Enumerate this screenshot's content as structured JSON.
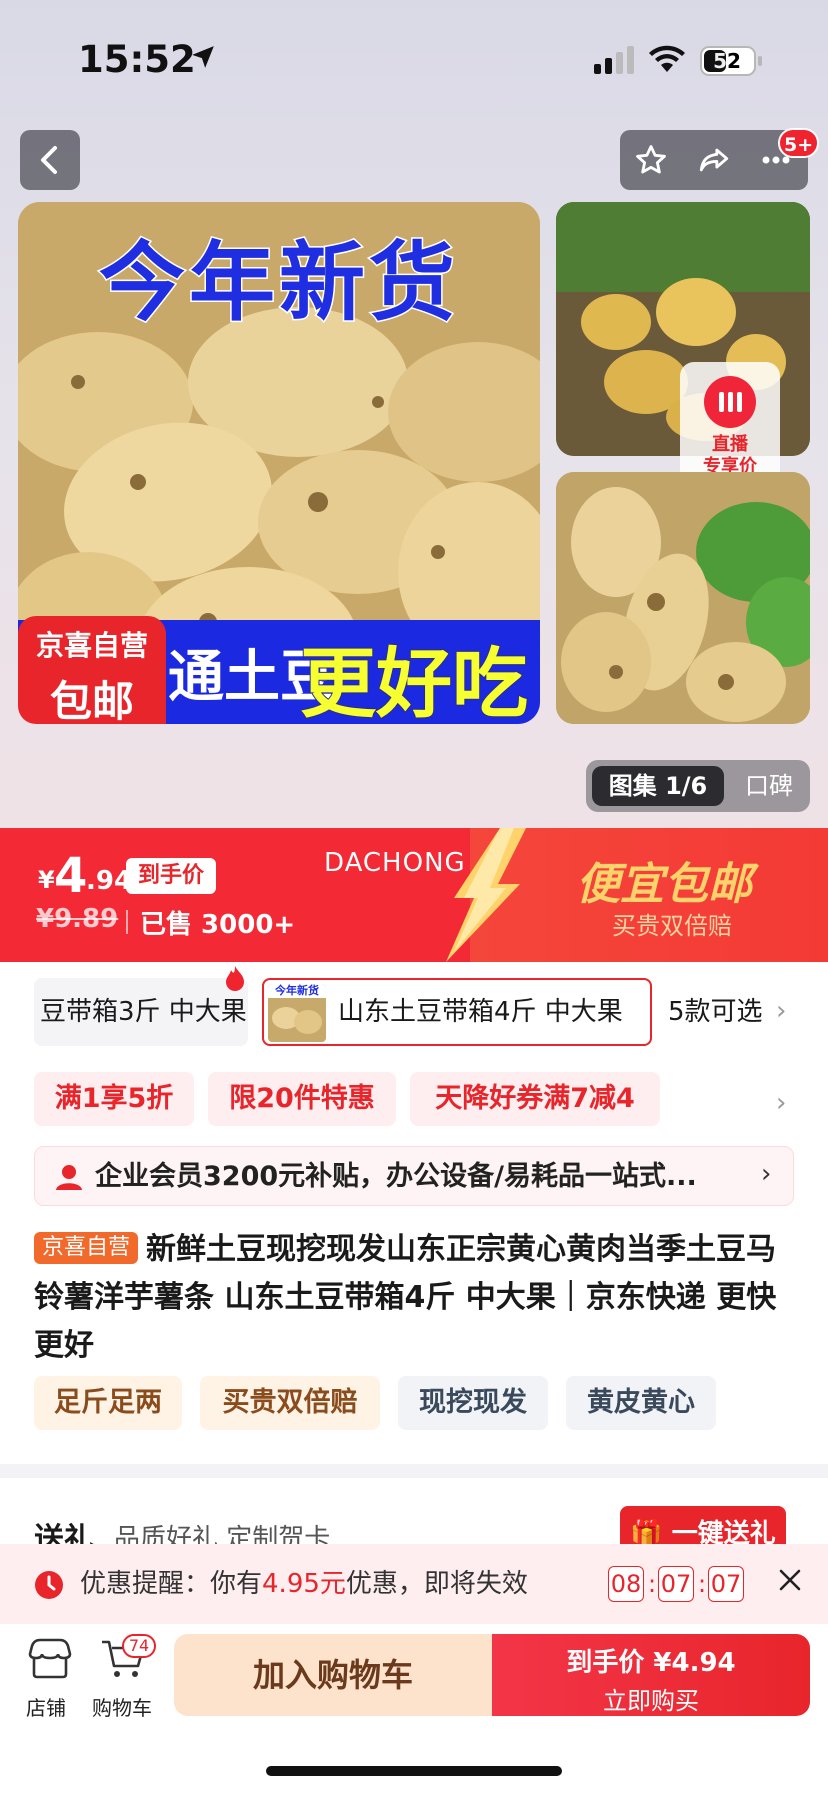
{
  "status": {
    "time": "15:52",
    "battery": "52"
  },
  "nav": {
    "badge": "5+"
  },
  "gallery": {
    "banner_top": "今年新货",
    "banner_bottom_a": "通土豆",
    "banner_bottom_b": "更好吃",
    "stamp_line1": "京喜自营",
    "stamp_line2": "包邮",
    "live_line1": "直播",
    "live_line2": "专享价",
    "album_label": "图集 1/6",
    "reviews_label": "口碑"
  },
  "price": {
    "yen": "¥",
    "integer": "4",
    "decimal": ".94",
    "daoshou_label": "到手价",
    "old_price": "¥9.89",
    "sold": "已售 3000+",
    "promo_brand": "DACHONG",
    "promo_title": "便宜包邮",
    "promo_sub": "买贵双倍赔"
  },
  "sku": {
    "prev": "豆带箱3斤 中大果",
    "selected": "山东土豆带箱4斤 中大果",
    "thumb_text": "今年新货",
    "more": "5款可选"
  },
  "coupons": [
    "满1享5折",
    "限20件特惠",
    "天降好券满7减4"
  ],
  "member_text": "企业会员3200元补贴，办公设备/易耗品一站式...",
  "product": {
    "tag": "京喜自营",
    "title": "新鲜土豆现挖现发山东正宗黄心黄肉当季土豆马铃薯洋芋薯条 山东土豆带箱4斤 中大果｜京东快递 更快更好"
  },
  "chips": [
    "足斤足两",
    "买贵双倍赔",
    "现挖现发",
    "黄皮黄心"
  ],
  "gift": {
    "title": "送礼",
    "subtitle": "品质好礼 定制贺卡",
    "button": "一键送礼"
  },
  "reminder": {
    "prefix": "优惠提醒：你有",
    "amount": "4.95元",
    "suffix": "优惠，即将失效",
    "h": "08",
    "m": "07",
    "s": "07"
  },
  "bottom": {
    "store": "店铺",
    "cart": "购物车",
    "cart_count": "74",
    "add_cart": "加入购物车",
    "buy_line1": "到手价 ¥4.94",
    "buy_line2": "立即购买"
  },
  "colors": {
    "brand_red": "#e8252b",
    "promo_gold": "#ffd36b",
    "title_blue": "#1f2ee0"
  }
}
